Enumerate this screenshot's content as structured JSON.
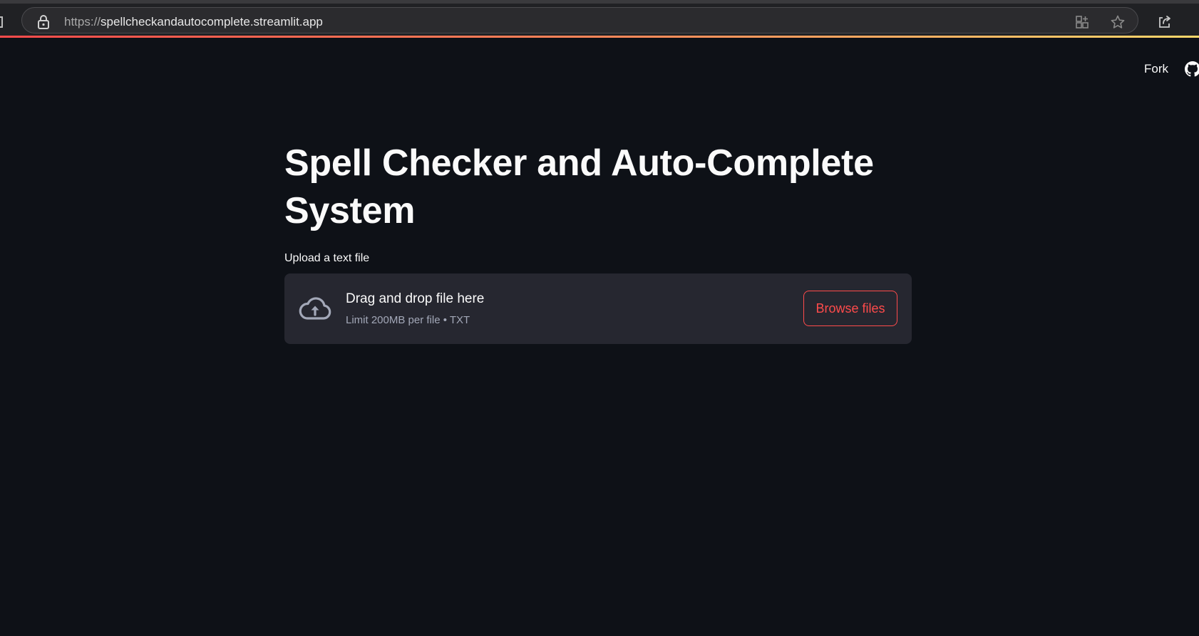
{
  "browser": {
    "url_protocol": "https://",
    "url_host": "spellcheckandautocomplete.streamlit.app",
    "icons": [
      "lock-icon",
      "app-install-icon",
      "star-icon",
      "share-icon"
    ]
  },
  "toolbar": {
    "fork_label": "Fork",
    "github_icon": "github-icon"
  },
  "main": {
    "title": "Spell Checker and Auto-Complete System",
    "uploader": {
      "label": "Upload a text file",
      "instructions": "Drag and drop file here",
      "limit": "Limit 200MB per file • TXT",
      "button_label": "Browse files",
      "icon": "cloud-upload-icon"
    }
  },
  "colors": {
    "background": "#0e1117",
    "accent": "#ff4b4b",
    "dropzone": "#262730",
    "text": "#fafafa",
    "muted_text": "#a3a8b8"
  }
}
